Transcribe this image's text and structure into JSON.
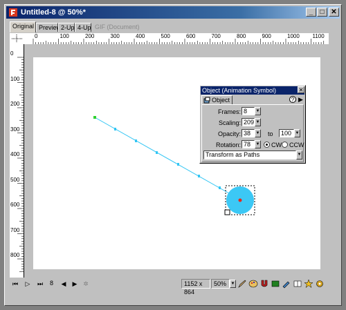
{
  "window": {
    "title": "Untitled-8 @ 50%*",
    "minimize": "_",
    "maximize": "□",
    "close": "✕"
  },
  "tabs": [
    {
      "label": "Original",
      "active": true
    },
    {
      "label": "Preview",
      "active": false
    },
    {
      "label": "2-Up",
      "active": false
    },
    {
      "label": "4-Up",
      "active": false
    },
    {
      "label": "GIF (Document)",
      "active": false,
      "disabled": true
    }
  ],
  "ruler": {
    "h_labels": [
      "0",
      "100",
      "200",
      "300",
      "400",
      "500",
      "600",
      "700",
      "800",
      "900",
      "1000",
      "1100"
    ],
    "v_labels": [
      "0",
      "100",
      "200",
      "300",
      "400",
      "500",
      "600",
      "700",
      "800"
    ]
  },
  "panel": {
    "title": "Object (Animation Symbol)",
    "close": "✕",
    "tab_label": "Object",
    "help": "?",
    "menu": "▶",
    "frames_label": "Frames:",
    "frames_value": "8",
    "scaling_label": "Scaling:",
    "scaling_value": "209",
    "opacity_label": "Opacity:",
    "opacity_from": "38",
    "opacity_to_label": "to",
    "opacity_to": "100",
    "rotation_label": "Rotation:",
    "rotation_value": "78",
    "cw_label": "CW",
    "ccw_label": "CCW",
    "direction": "CW",
    "transform_option": "Transform as Paths"
  },
  "status": {
    "frame": "8",
    "doc_size": "1152 x 864",
    "zoom": "50%"
  },
  "colors": {
    "titlebar": "#0a246a",
    "path": "#33c6f4",
    "symbol_fill": "#3cc8f5",
    "start_point": "#2fd02f",
    "center_point": "#e8261a"
  }
}
